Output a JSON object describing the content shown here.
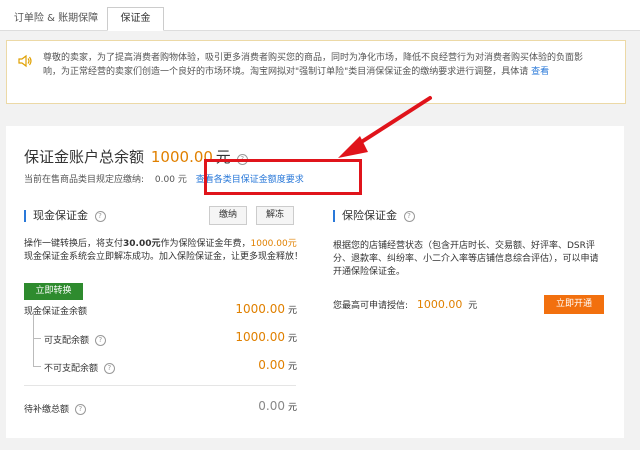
{
  "tabs": [
    {
      "label": "订单险 & 账期保障"
    },
    {
      "label": "保证金"
    }
  ],
  "notice": {
    "text": "尊敬的卖家，为了提高消费者购物体验，吸引更多消费者购买您的商品，同时为净化市场，降低不良经营行为对消费者购买体验的负面影响，为正常经营的卖家们创造一个良好的市场环境。淘宝网拟对\"强制订单险\"类目消保保证金的缴纳要求进行调整，具体请",
    "link": "查看"
  },
  "summary": {
    "label": "保证金账户总余额",
    "amount": "1000.00",
    "unit": "元",
    "help": "?",
    "req_label": "当前在售商品类目规定应缴纳:",
    "req_value": "0.00 元",
    "req_link": "查看各类目保证金额度要求"
  },
  "cash": {
    "title": "现金保证金",
    "pay_btn": "缴纳",
    "release_btn": "解冻",
    "desc_a": "操作一键转换后，将支付",
    "desc_fee": "30.00元",
    "desc_b": "作为保险保证金年费，",
    "desc_amt": "1000.00元",
    "desc_c": "现金保证金系统会立即解冻成功。加入保险保证金，让更多现金释放！",
    "convert_btn": "立即转换",
    "balance_label": "现金保证金余额",
    "balance_value": "1000.00",
    "available_label": "可支配余额",
    "available_value": "1000.00",
    "unavailable_label": "不可支配余额",
    "unavailable_value": "0.00",
    "pending_label": "待补缴总额",
    "pending_value": "0.00",
    "unit": "元"
  },
  "insurance": {
    "title": "保险保证金",
    "desc": "根据您的店铺经营状态（包含开店时长、交易额、好评率、DSR评分、退款率、纠纷率、小二介入率等店铺信息综合评估），可以申请开通保险保证金。",
    "max_label": "您最高可申请授信:",
    "max_value": "1000.00",
    "unit": "元",
    "open_btn": "立即开通"
  },
  "colors": {
    "accent_orange": "#e08000",
    "link_blue": "#2a79d9",
    "highlight_red": "#e0141b",
    "btn_green": "#2e8b2e",
    "btn_orange": "#f2700e"
  }
}
